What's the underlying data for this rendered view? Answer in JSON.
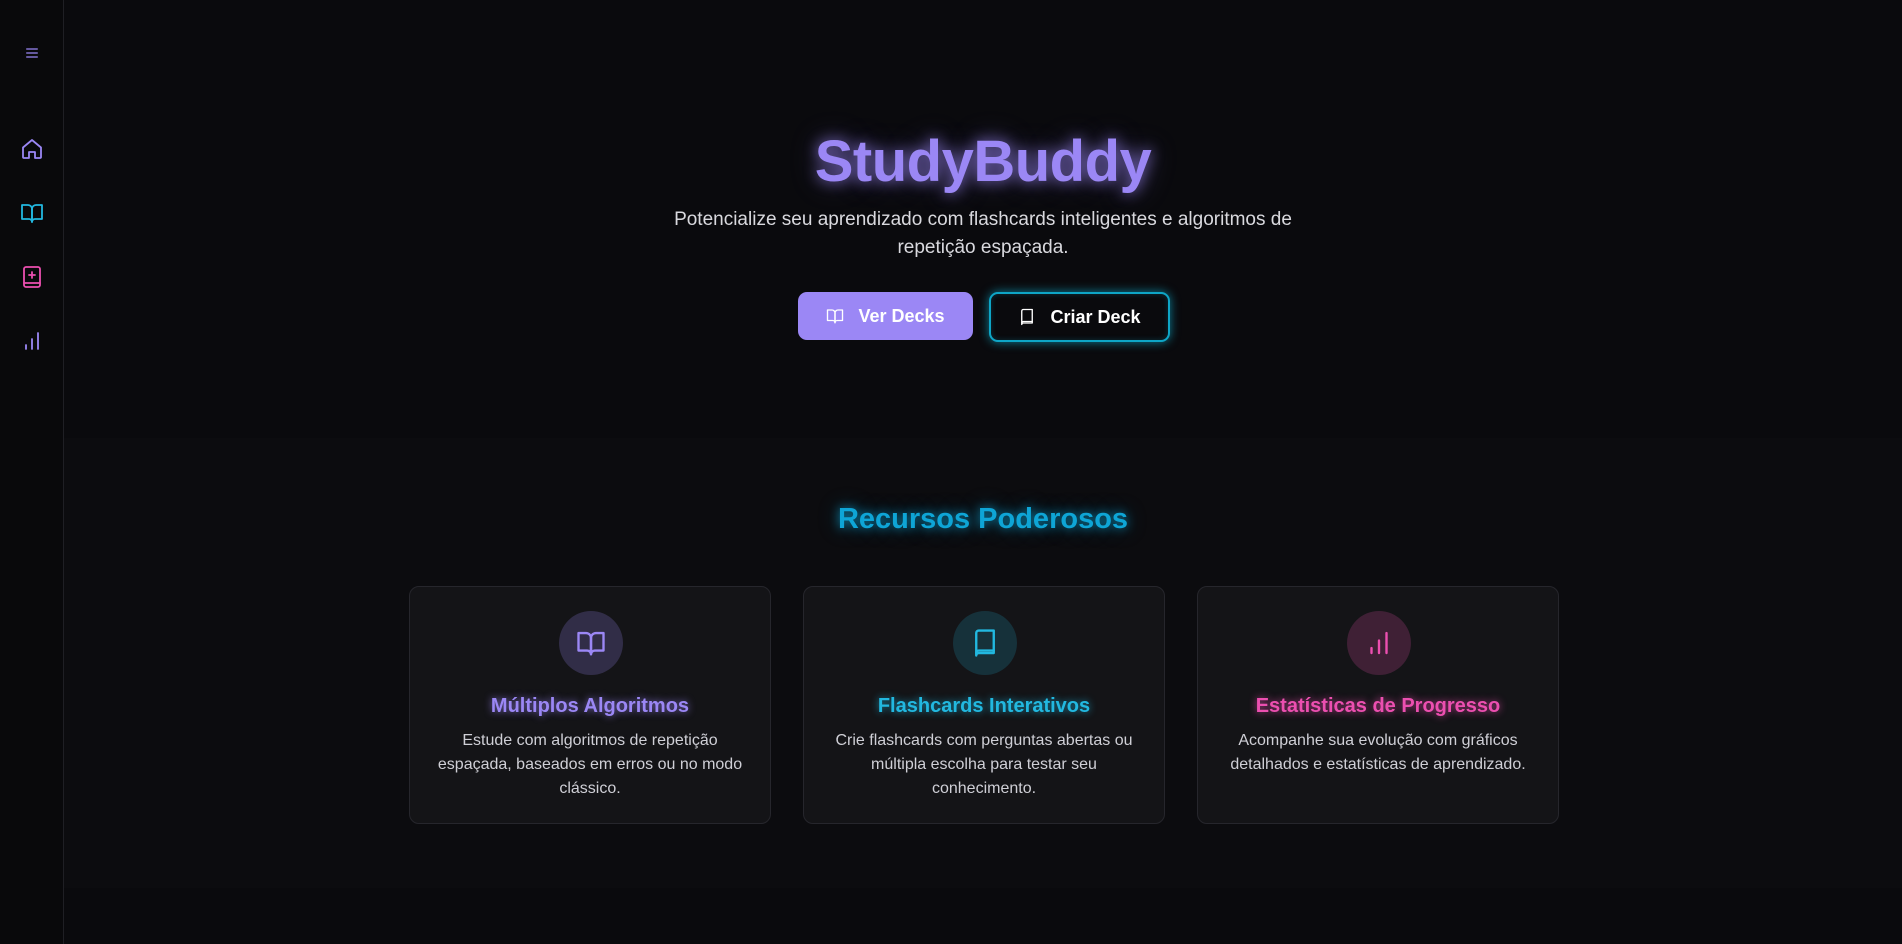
{
  "app": {
    "name": "StudyBuddy"
  },
  "sidebar": {
    "items": [
      {
        "icon": "menu-icon",
        "color": "#9b87f5"
      },
      {
        "icon": "home-icon",
        "color": "#9b87f5"
      },
      {
        "icon": "book-open-icon",
        "color": "#22b8e0"
      },
      {
        "icon": "book-plus-icon",
        "color": "#ec4fb0"
      },
      {
        "icon": "bar-chart-icon",
        "color": "#9b87f5"
      }
    ]
  },
  "hero": {
    "title": "StudyBuddy",
    "subtitle": "Potencialize seu aprendizado com flashcards inteligentes e algoritmos de repetição espaçada.",
    "primary_button": {
      "label": "Ver Decks",
      "icon": "book-open-icon"
    },
    "secondary_button": {
      "label": "Criar Deck",
      "icon": "book-icon"
    }
  },
  "features": {
    "title": "Recursos Poderosos",
    "cards": [
      {
        "title": "Múltiplos Algoritmos",
        "description": "Estude com algoritmos de repetição espaçada, baseados em erros ou no modo clássico.",
        "icon": "book-open-icon",
        "color": "#9b87f5"
      },
      {
        "title": "Flashcards Interativos",
        "description": "Crie flashcards com perguntas abertas ou múltipla escolha para testar seu conhecimento.",
        "icon": "book-icon",
        "color": "#22b8e0"
      },
      {
        "title": "Estatísticas de Progresso",
        "description": "Acompanhe sua evolução com gráficos detalhados e estatísticas de aprendizado.",
        "icon": "bar-chart-icon",
        "color": "#ec4fb0"
      }
    ]
  },
  "colors": {
    "background": "#0b0b0e",
    "purple": "#9b87f5",
    "cyan": "#0ea5d6",
    "pink": "#ec4fb0"
  }
}
